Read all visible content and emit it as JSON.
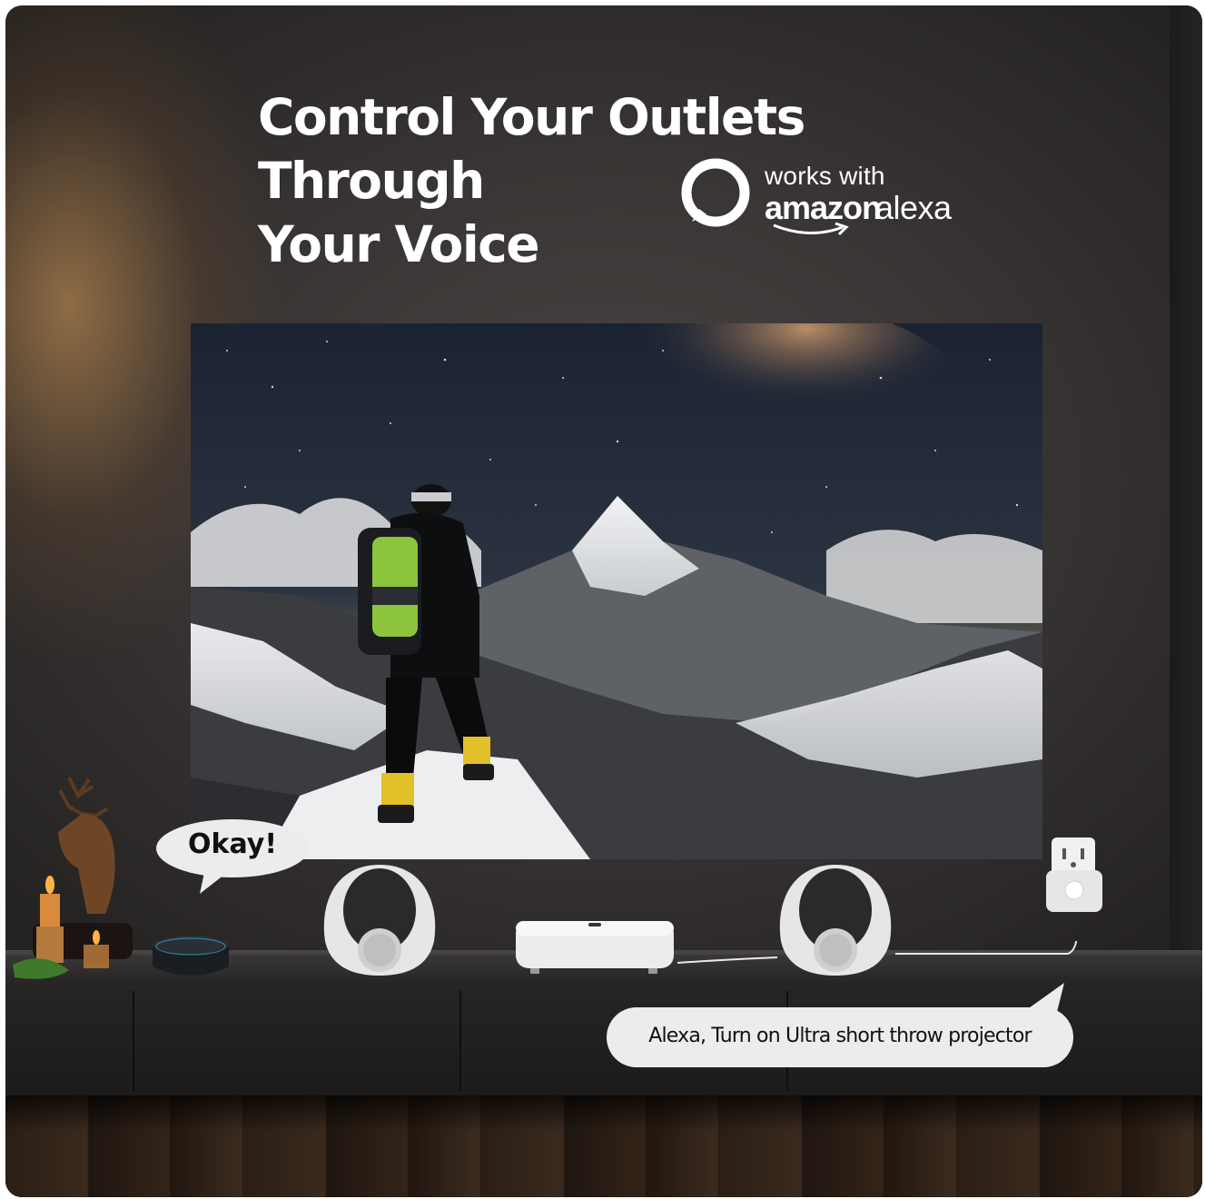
{
  "headline": {
    "line1": "Control Your Outlets Through",
    "line2": "Your Voice"
  },
  "badge": {
    "works_with": "works with",
    "brand": "amazon",
    "product": "alexa"
  },
  "bubbles": {
    "reply": "Okay!",
    "command": "Alexa, Turn on Ultra short throw projector"
  },
  "colors": {
    "text_primary": "#ffffff",
    "bubble_bg": "#ececec",
    "bubble_text": "#111111",
    "jacket_accent": "#8cc43c",
    "boot_accent": "#e2c02a"
  },
  "icons": {
    "alexa_logo": "alexa-ring-icon",
    "outlet": "smart-plug-icon",
    "speaker": "speaker-icon",
    "projector": "projector-icon",
    "echo_dot": "echo-dot-icon"
  }
}
